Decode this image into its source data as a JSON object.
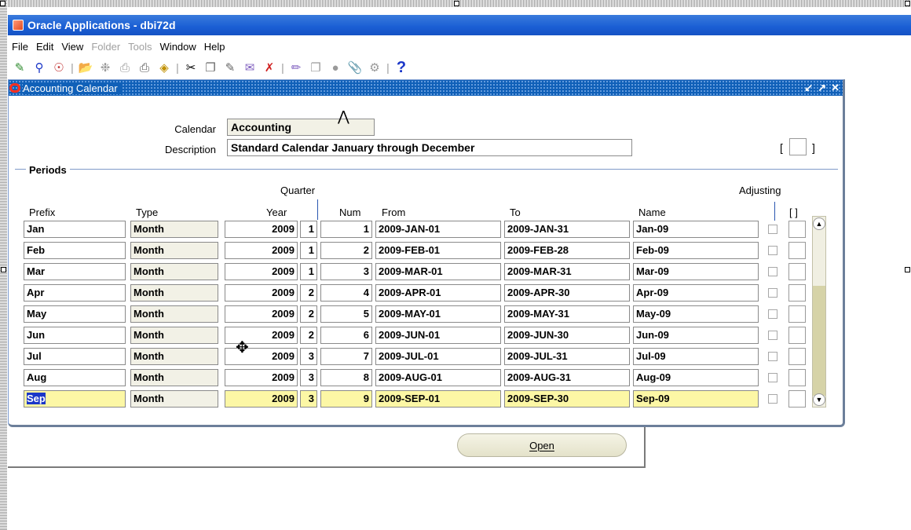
{
  "app": {
    "title": "Oracle Applications - dbi72d"
  },
  "menu": [
    {
      "label": "File",
      "enabled": true
    },
    {
      "label": "Edit",
      "enabled": true
    },
    {
      "label": "View",
      "enabled": true
    },
    {
      "label": "Folder",
      "enabled": false
    },
    {
      "label": "Tools",
      "enabled": false
    },
    {
      "label": "Window",
      "enabled": true
    },
    {
      "label": "Help",
      "enabled": true
    }
  ],
  "toolbar": {
    "icons": [
      "new-record-icon",
      "find-icon",
      "navigator-icon",
      "open-folder-icon",
      "save-icon",
      "print-icon",
      "close-form-icon",
      "cut-icon",
      "copy-icon",
      "paste-icon",
      "clear-record-icon",
      "delete-record-icon",
      "edit-field-icon",
      "zoom-icon",
      "translation-icon",
      "attachments-icon",
      "folder-tools-icon",
      "help-icon"
    ],
    "help_label": "?"
  },
  "window": {
    "title": "Accounting Calendar"
  },
  "form": {
    "calendar_label": "Calendar",
    "calendar_value": "Accounting",
    "description_label": "Description",
    "description_value": "Standard Calendar January through December",
    "bracket_open": "[",
    "bracket_close": "]"
  },
  "periods": {
    "section_label": "Periods",
    "header_quarter": "Quarter",
    "header_adjusting": "Adjusting",
    "columns": {
      "prefix": "Prefix",
      "type": "Type",
      "year": "Year",
      "num": "Num",
      "from": "From",
      "to": "To",
      "name": "Name",
      "flex": "[ ]"
    },
    "rows": [
      {
        "prefix": "Jan",
        "type": "Month",
        "year": "2009",
        "quarter": "1",
        "num": "1",
        "from": "2009-JAN-01",
        "to": "2009-JAN-31",
        "name": "Jan-09",
        "adjusting": false
      },
      {
        "prefix": "Feb",
        "type": "Month",
        "year": "2009",
        "quarter": "1",
        "num": "2",
        "from": "2009-FEB-01",
        "to": "2009-FEB-28",
        "name": "Feb-09",
        "adjusting": false
      },
      {
        "prefix": "Mar",
        "type": "Month",
        "year": "2009",
        "quarter": "1",
        "num": "3",
        "from": "2009-MAR-01",
        "to": "2009-MAR-31",
        "name": "Mar-09",
        "adjusting": false
      },
      {
        "prefix": "Apr",
        "type": "Month",
        "year": "2009",
        "quarter": "2",
        "num": "4",
        "from": "2009-APR-01",
        "to": "2009-APR-30",
        "name": "Apr-09",
        "adjusting": false
      },
      {
        "prefix": "May",
        "type": "Month",
        "year": "2009",
        "quarter": "2",
        "num": "5",
        "from": "2009-MAY-01",
        "to": "2009-MAY-31",
        "name": "May-09",
        "adjusting": false
      },
      {
        "prefix": "Jun",
        "type": "Month",
        "year": "2009",
        "quarter": "2",
        "num": "6",
        "from": "2009-JUN-01",
        "to": "2009-JUN-30",
        "name": "Jun-09",
        "adjusting": false
      },
      {
        "prefix": "Jul",
        "type": "Month",
        "year": "2009",
        "quarter": "3",
        "num": "7",
        "from": "2009-JUL-01",
        "to": "2009-JUL-31",
        "name": "Jul-09",
        "adjusting": false
      },
      {
        "prefix": "Aug",
        "type": "Month",
        "year": "2009",
        "quarter": "3",
        "num": "8",
        "from": "2009-AUG-01",
        "to": "2009-AUG-31",
        "name": "Aug-09",
        "adjusting": false
      },
      {
        "prefix": "Sep",
        "type": "Month",
        "year": "2009",
        "quarter": "3",
        "num": "9",
        "from": "2009-SEP-01",
        "to": "2009-SEP-30",
        "name": "Sep-09",
        "adjusting": false
      }
    ],
    "current_row_index": 8
  },
  "buttons": {
    "open_label": "Open"
  },
  "colors": {
    "titlebar": "#1a5ed4",
    "current_row": "#fcf7a5",
    "selection": "#1a36c8"
  }
}
